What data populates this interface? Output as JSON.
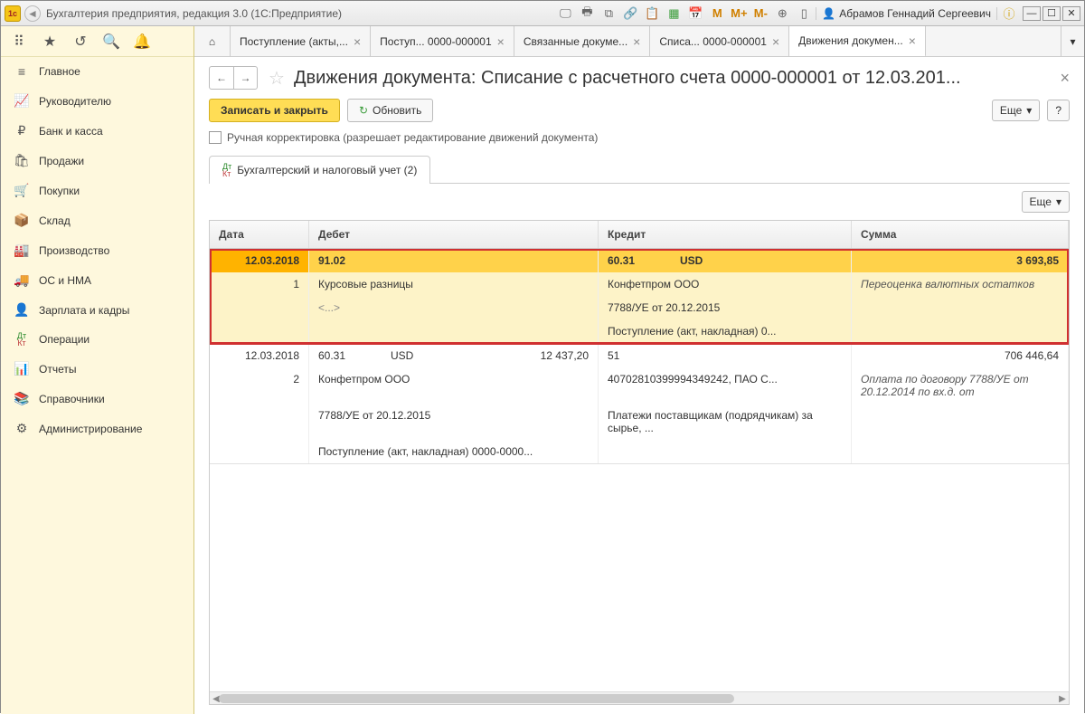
{
  "titlebar": {
    "app_title": "Бухгалтерия предприятия, редакция 3.0  (1С:Предприятие)",
    "user_name": "Абрамов Геннадий Сергеевич",
    "m_labels": [
      "M",
      "M+",
      "M-"
    ]
  },
  "sidebar": {
    "items": [
      {
        "icon": "≡",
        "label": "Главное"
      },
      {
        "icon": "📈",
        "label": "Руководителю"
      },
      {
        "icon": "₽",
        "label": "Банк и касса"
      },
      {
        "icon": "🛍",
        "label": "Продажи"
      },
      {
        "icon": "🛒",
        "label": "Покупки"
      },
      {
        "icon": "📦",
        "label": "Склад"
      },
      {
        "icon": "🏭",
        "label": "Производство"
      },
      {
        "icon": "🚚",
        "label": "ОС и НМА"
      },
      {
        "icon": "👤",
        "label": "Зарплата и кадры"
      },
      {
        "icon": "ДтКт",
        "label": "Операции"
      },
      {
        "icon": "📊",
        "label": "Отчеты"
      },
      {
        "icon": "📚",
        "label": "Справочники"
      },
      {
        "icon": "⚙",
        "label": "Администрирование"
      }
    ]
  },
  "tabs": [
    {
      "label": "Поступление (акты,...",
      "active": false
    },
    {
      "label": "Поступ... 0000-000001",
      "active": false
    },
    {
      "label": "Связанные докуме...",
      "active": false
    },
    {
      "label": "Списа... 0000-000001",
      "active": false
    },
    {
      "label": "Движения докумен...",
      "active": true
    }
  ],
  "page": {
    "title": "Движения документа: Списание с расчетного счета 0000-000001 от 12.03.201...",
    "save_close": "Записать и закрыть",
    "refresh": "Обновить",
    "more": "Еще",
    "help": "?",
    "manual_edit": "Ручная корректировка (разрешает редактирование движений документа)",
    "subtab": "Бухгалтерский и налоговый учет (2)"
  },
  "grid": {
    "headers": {
      "date": "Дата",
      "debit": "Дебет",
      "credit": "Кредит",
      "sum": "Сумма"
    },
    "more": "Еще",
    "entries": [
      {
        "highlight": true,
        "rows": [
          {
            "date": "12.03.2018",
            "debit_acc": "91.02",
            "debit_cur": "",
            "debit_amt": "",
            "credit_acc": "60.31",
            "credit_cur": "USD",
            "sum": "3 693,85",
            "sum_note": ""
          },
          {
            "date": "1",
            "debit_text": "Курсовые разницы",
            "credit_text": "Конфетпром ООО",
            "sum_note": "Переоценка валютных остатков",
            "italic_sum": true
          },
          {
            "date": "",
            "debit_text": "<...>",
            "credit_text": "7788/УЕ от 20.12.2015",
            "ellipsis": true
          },
          {
            "date": "",
            "debit_text": "",
            "credit_text": "Поступление (акт, накладная) 0..."
          }
        ]
      },
      {
        "highlight": false,
        "rows": [
          {
            "date": "12.03.2018",
            "debit_acc": "60.31",
            "debit_cur": "USD",
            "debit_amt": "12 437,20",
            "credit_acc": "51",
            "credit_cur": "",
            "sum": "706 446,64"
          },
          {
            "date": "2",
            "debit_text": "Конфетпром ООО",
            "credit_text": "40702810399994349242, ПАО С...",
            "sum_note": "Оплата по договору 7788/УЕ от 20.12.2014 по вх.д.  от",
            "italic_sum": true
          },
          {
            "date": "",
            "debit_text": "7788/УЕ от 20.12.2015",
            "credit_text": "Платежи поставщикам (подрядчикам) за сырье, ..."
          },
          {
            "date": "",
            "debit_text": "Поступление (акт, накладная) 0000-0000...",
            "credit_text": ""
          }
        ]
      }
    ]
  }
}
